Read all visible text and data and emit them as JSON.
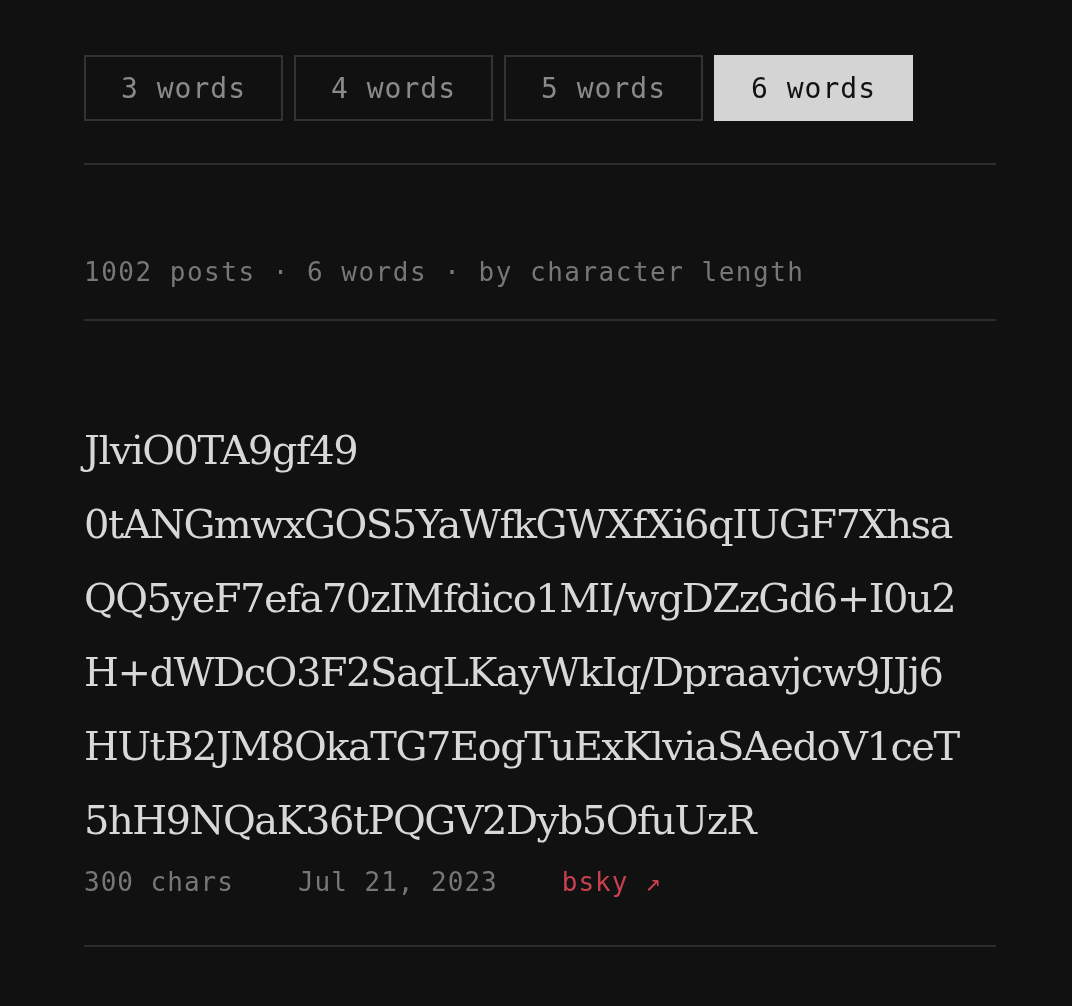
{
  "tabs": [
    {
      "label": "3 words",
      "selected": false
    },
    {
      "label": "4 words",
      "selected": false
    },
    {
      "label": "5 words",
      "selected": false
    },
    {
      "label": "6 words",
      "selected": true
    }
  ],
  "summary": "1002 posts · 6 words · by character length",
  "post": {
    "lines": [
      "JlviO0TA9gf49",
      "0tANGmwxGOS5YaWfkGWXfXi6qIUGF7Xhsa",
      "QQ5yeF7efa70zIMfdico1MI/wgDZzGd6+I0u2",
      "H+dWDcO3F2SaqLKayWkIq/Dpraavjcw9JJj6",
      "HUtB2JM8OkaTG7EogTuExKlviaSAedoV1ceT",
      "5hH9NQaK36tPQGV2Dyb5OfuUzR"
    ],
    "chars": "300 chars",
    "date": "Jul 21, 2023",
    "link": "bsky ↗"
  }
}
